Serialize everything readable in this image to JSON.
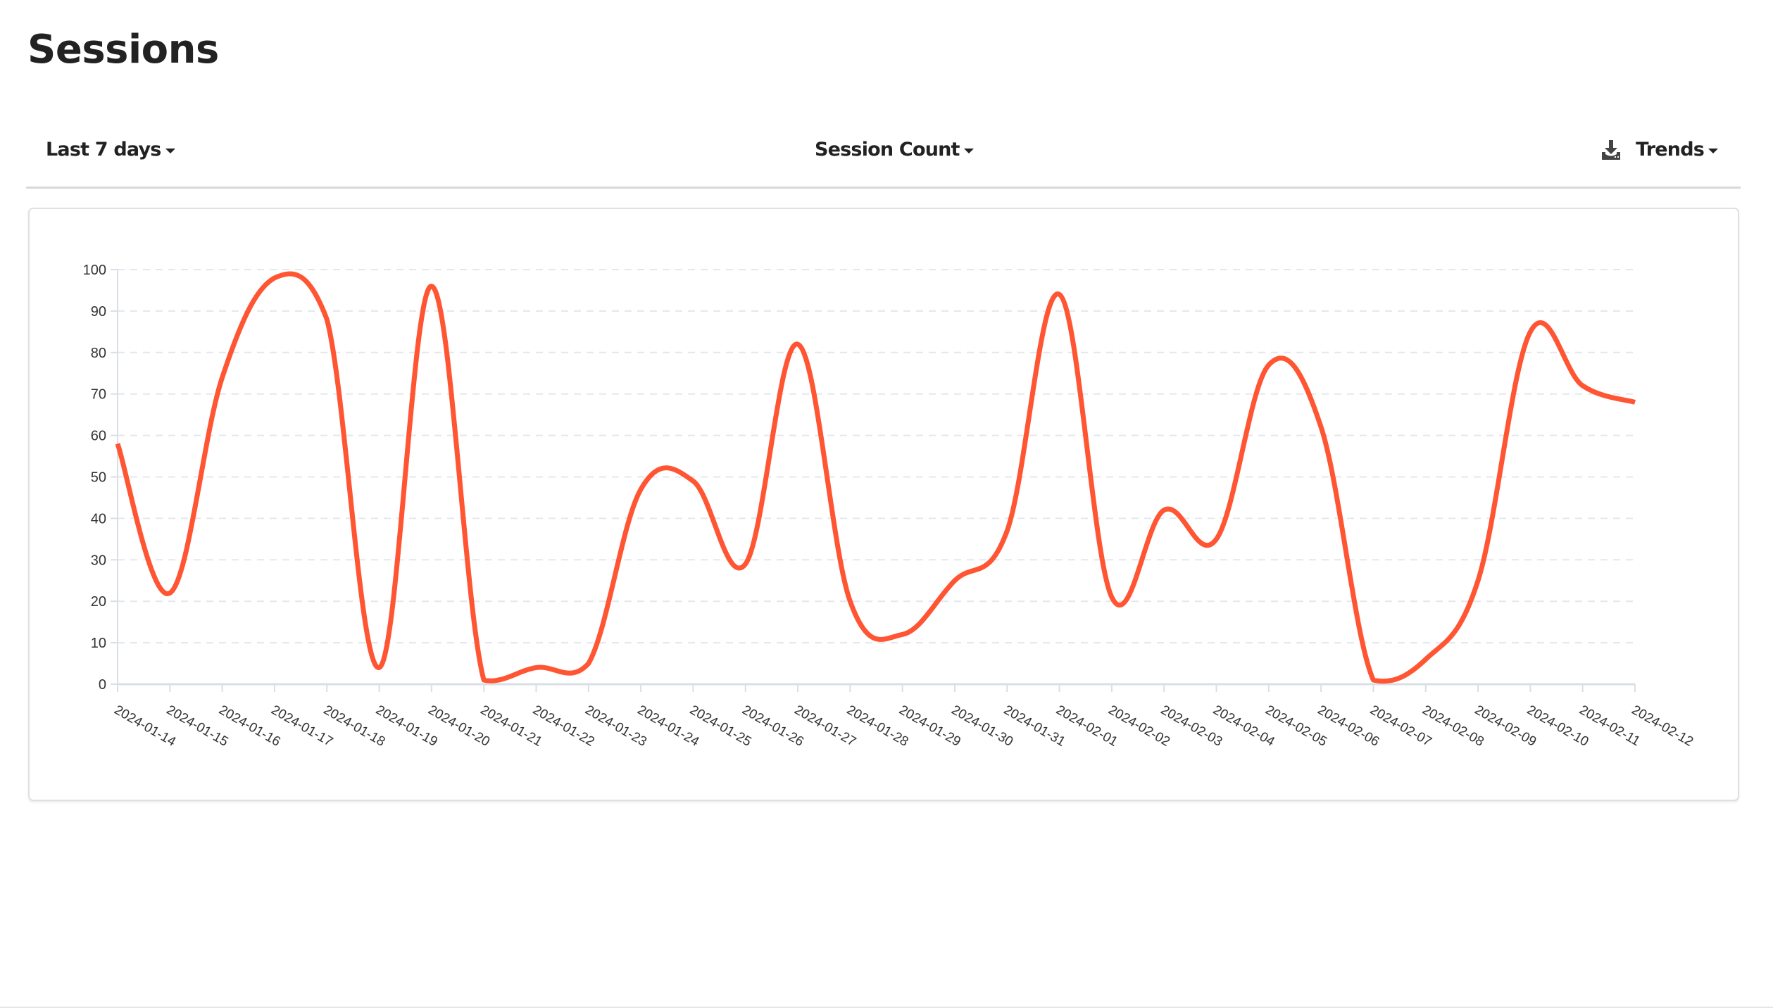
{
  "page": {
    "title": "Sessions"
  },
  "toolbar": {
    "range_label": "Last 7 days",
    "metric_label": "Session Count",
    "trends_label": "Trends",
    "download_icon": "download-icon",
    "caret_icon": "caret-down-icon"
  },
  "colors": {
    "series": "#ff5533",
    "grid": "#e3e7ee",
    "axis": "#d9dee7",
    "tick_text": "#333333"
  },
  "chart_data": {
    "type": "line",
    "title": "",
    "xlabel": "",
    "ylabel": "",
    "ylim": [
      0,
      100
    ],
    "yticks": [
      0,
      10,
      20,
      30,
      40,
      50,
      60,
      70,
      80,
      90,
      100
    ],
    "grid": true,
    "legend": "none",
    "smooth": true,
    "categories": [
      "2024-01-14",
      "2024-01-15",
      "2024-01-16",
      "2024-01-17",
      "2024-01-18",
      "2024-01-19",
      "2024-01-20",
      "2024-01-21",
      "2024-01-22",
      "2024-01-23",
      "2024-01-24",
      "2024-01-25",
      "2024-01-26",
      "2024-01-27",
      "2024-01-28",
      "2024-01-29",
      "2024-01-30",
      "2024-01-31",
      "2024-02-01",
      "2024-02-02",
      "2024-02-03",
      "2024-02-04",
      "2024-02-05",
      "2024-02-06",
      "2024-02-07",
      "2024-02-08",
      "2024-02-09",
      "2024-02-10",
      "2024-02-11",
      "2024-02-12"
    ],
    "series": [
      {
        "name": "Session Count",
        "values": [
          58,
          22,
          74,
          98,
          88,
          4,
          96,
          1,
          4,
          5,
          47,
          49,
          29,
          82,
          20,
          12,
          25,
          37,
          94,
          21,
          42,
          35,
          77,
          62,
          1,
          6,
          25,
          85,
          72,
          68
        ]
      }
    ]
  }
}
